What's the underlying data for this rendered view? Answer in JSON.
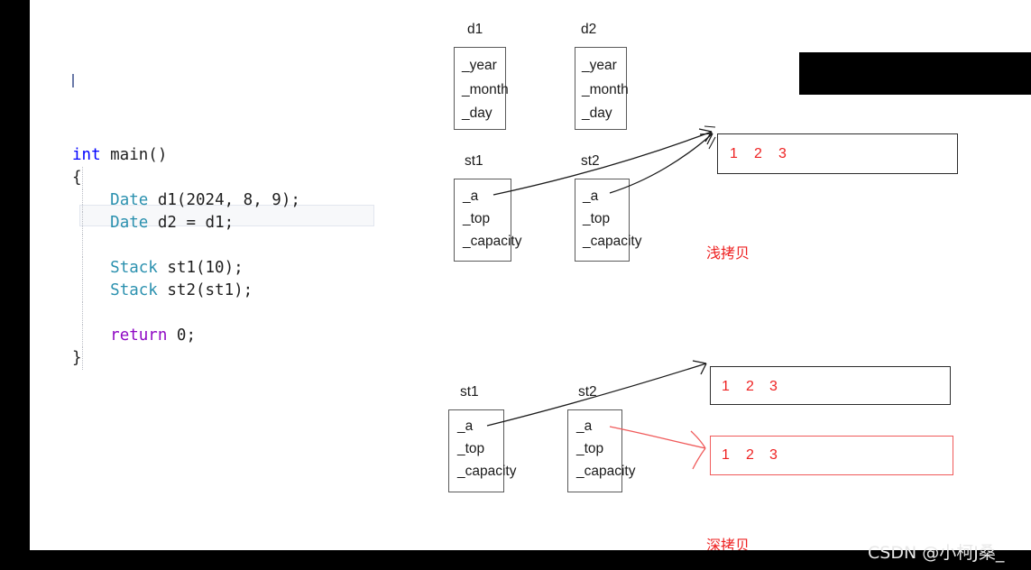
{
  "code": {
    "language": "cpp",
    "lines": [
      [
        {
          "t": "int",
          "c": "kw"
        },
        {
          "t": " main()",
          "c": "plain"
        }
      ],
      [
        {
          "t": "{",
          "c": "plain"
        }
      ],
      [
        {
          "t": "    ",
          "c": "plain"
        },
        {
          "t": "Date",
          "c": "type"
        },
        {
          "t": " d1(2024, 8, 9);",
          "c": "plain"
        }
      ],
      [
        {
          "t": "    ",
          "c": "plain"
        },
        {
          "t": "Date",
          "c": "type"
        },
        {
          "t": " d2 = d1;",
          "c": "plain"
        }
      ],
      [
        {
          "t": "",
          "c": "plain"
        }
      ],
      [
        {
          "t": "    ",
          "c": "plain"
        },
        {
          "t": "Stack",
          "c": "type"
        },
        {
          "t": " st1(10);",
          "c": "plain"
        }
      ],
      [
        {
          "t": "    ",
          "c": "plain"
        },
        {
          "t": "Stack",
          "c": "type"
        },
        {
          "t": " st2(st1);",
          "c": "plain"
        }
      ],
      [
        {
          "t": "",
          "c": "plain"
        }
      ],
      [
        {
          "t": "    ",
          "c": "plain"
        },
        {
          "t": "return",
          "c": "ctrl"
        },
        {
          "t": " 0;",
          "c": "plain"
        }
      ],
      [
        {
          "t": "}",
          "c": "plain"
        }
      ]
    ],
    "active_line_index": 4
  },
  "diagram": {
    "shallow": {
      "note": "浅拷贝",
      "objects": [
        {
          "name": "d1",
          "fields": [
            "_year",
            "_month",
            "_day"
          ]
        },
        {
          "name": "d2",
          "fields": [
            "_year",
            "_month",
            "_day"
          ]
        },
        {
          "name": "st1",
          "fields": [
            "_a",
            "_top",
            "_capacity"
          ]
        },
        {
          "name": "st2",
          "fields": [
            "_a",
            "_top",
            "_capacity"
          ]
        }
      ],
      "arrays": [
        {
          "border_color": "#2b2b2b",
          "values": [
            "1",
            "2",
            "3"
          ]
        }
      ]
    },
    "deep": {
      "note": "深拷贝",
      "objects": [
        {
          "name": "st1",
          "fields": [
            "_a",
            "_top",
            "_capacity"
          ]
        },
        {
          "name": "st2",
          "fields": [
            "_a",
            "_top",
            "_capacity"
          ]
        }
      ],
      "arrays": [
        {
          "border_color": "#2b2b2b",
          "values": [
            "1",
            "2",
            "3"
          ]
        },
        {
          "border_color": "#f05a5a",
          "values": [
            "1",
            "2",
            "3"
          ]
        }
      ]
    }
  },
  "watermark": {
    "text": "CSDN @小柯J桑_"
  },
  "colors": {
    "keyword": "#0000ff",
    "type": "#2b91af",
    "control": "#8f08c4",
    "plain": "#1f1f1f",
    "array_value": "#ee2222",
    "note": "#ee2222",
    "box_border": "#5a5a5a",
    "redaction": "#000000"
  }
}
